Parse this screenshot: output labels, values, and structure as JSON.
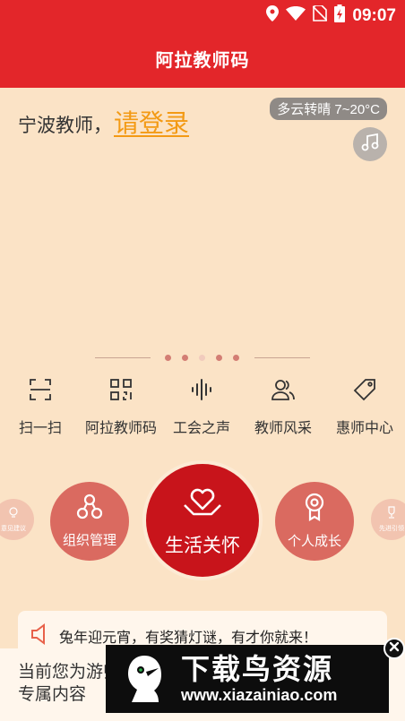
{
  "status_bar": {
    "time": "09:07",
    "icons": [
      "location-icon",
      "wifi-icon",
      "no-sim-icon",
      "battery-charging-icon"
    ]
  },
  "header": {
    "title": "阿拉教师码"
  },
  "greeting": {
    "prefix": "宁波教师，",
    "login_link": "请登录"
  },
  "weather": {
    "text": "多云转晴 7~20°C"
  },
  "carousel": {
    "dot_count": 5,
    "active_index": 2
  },
  "quick_menu": [
    {
      "label": "扫一扫",
      "icon": "scan-icon"
    },
    {
      "label": "阿拉教师码",
      "icon": "qr-code-icon"
    },
    {
      "label": "工会之声",
      "icon": "sound-wave-icon"
    },
    {
      "label": "教师风采",
      "icon": "people-icon"
    },
    {
      "label": "惠师中心",
      "icon": "tag-icon"
    }
  ],
  "feature_circles": [
    {
      "label": "意见建议",
      "icon": "lightbulb-icon"
    },
    {
      "label": "组织管理",
      "icon": "org-icon"
    },
    {
      "label": "生活关怀",
      "icon": "heart-hand-icon"
    },
    {
      "label": "个人成长",
      "icon": "award-icon"
    },
    {
      "label": "先进引领",
      "icon": "trophy-icon"
    }
  ],
  "notice": {
    "text": "兔年迎元宵，有奖猜灯谜，有才你就来！",
    "icon": "speaker-icon"
  },
  "bottom_panel": {
    "text": "当前您为游师专属内容"
  },
  "ad": {
    "title": "下载鸟资源",
    "url": "www.xiazainiao.com",
    "close_icon": "close-icon"
  },
  "colors": {
    "primary_red": "#e3262a",
    "background": "#fbe3c6",
    "link_orange": "#f39a14"
  }
}
